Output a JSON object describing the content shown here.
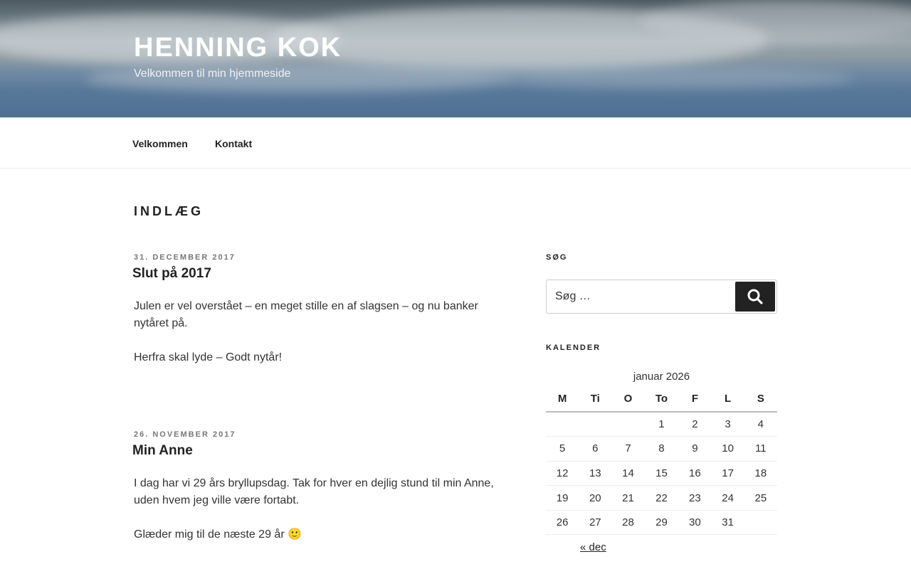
{
  "site": {
    "title": "HENNING KOK",
    "description": "Velkommen til min hjemmeside"
  },
  "nav": {
    "items": [
      "Velkommen",
      "Kontakt"
    ]
  },
  "page": {
    "title": "INDLÆG"
  },
  "posts": [
    {
      "date": "31. DECEMBER 2017",
      "title": "Slut på 2017",
      "paragraphs": [
        "Julen er vel overstået – en meget stille en af slagsen – og nu banker nytåret på.",
        "Herfra skal lyde – Godt nytår!"
      ]
    },
    {
      "date": "26. NOVEMBER 2017",
      "title": "Min Anne",
      "paragraphs": [
        "I dag har vi 29 års bryllupsdag. Tak for hver en dejlig stund til min Anne, uden hvem jeg ville være fortabt.",
        "Glæder mig til de næste 29 år 🙂"
      ]
    }
  ],
  "sidebar": {
    "search": {
      "title": "SØG",
      "placeholder": "Søg …",
      "button_icon": "search-icon"
    },
    "calendar": {
      "title": "KALENDER",
      "caption": "januar 2026",
      "weekdays": [
        "M",
        "Ti",
        "O",
        "To",
        "F",
        "L",
        "S"
      ],
      "weeks": [
        [
          "",
          "",
          "",
          "1",
          "2",
          "3",
          "4"
        ],
        [
          "5",
          "6",
          "7",
          "8",
          "9",
          "10",
          "11"
        ],
        [
          "12",
          "13",
          "14",
          "15",
          "16",
          "17",
          "18"
        ],
        [
          "19",
          "20",
          "21",
          "22",
          "23",
          "24",
          "25"
        ],
        [
          "26",
          "27",
          "28",
          "29",
          "30",
          "31",
          ""
        ]
      ],
      "prev_link": "« dec"
    }
  }
}
